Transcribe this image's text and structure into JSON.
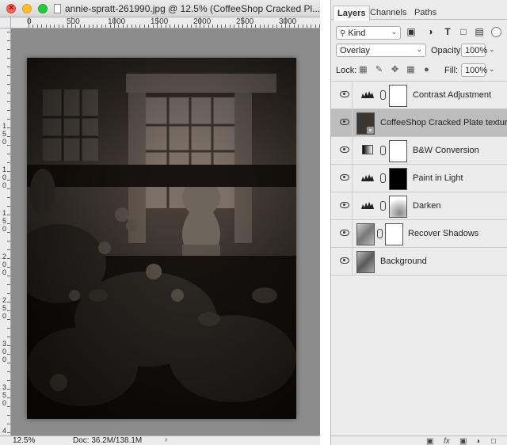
{
  "window": {
    "title": "annie-spratt-261990.jpg @ 12.5% (CoffeeShop Cracked Pl..."
  },
  "ruler": {
    "top_labels": [
      "0",
      "500",
      "1000",
      "1500",
      "2000",
      "2500",
      "3000"
    ],
    "left_labels": [
      "1",
      "5",
      "0",
      "1",
      "0",
      "0",
      "1",
      "5",
      "0",
      "2",
      "0",
      "0",
      "2",
      "5",
      "0",
      "3",
      "0",
      "0",
      "3",
      "5",
      "0",
      "4",
      "0",
      "0"
    ]
  },
  "status": {
    "zoom": "12.5%",
    "doc": "Doc: 36.2M/138.1M",
    "arrow": "›"
  },
  "panel": {
    "tabs": [
      "Layers",
      "Channels",
      "Paths"
    ],
    "kind_label": "Kind",
    "filter_icons": [
      "image-filter-icon",
      "adjustment-filter-icon",
      "type-filter-icon",
      "shape-filter-icon",
      "smart-object-filter-icon"
    ],
    "blend_mode": "Overlay",
    "opacity_label": "Opacity:",
    "opacity_value": "100%",
    "lock_label": "Lock:",
    "fill_label": "Fill:",
    "fill_value": "100%",
    "layers": [
      {
        "name": "Contrast Adjustment",
        "kind": "curves",
        "selected": false
      },
      {
        "name": "CoffeeShop Cracked Plate texture",
        "kind": "smart-object",
        "selected": true
      },
      {
        "name": "B&W Conversion",
        "kind": "gradient",
        "selected": false
      },
      {
        "name": "Paint in Light",
        "kind": "curves-black-mask",
        "selected": false
      },
      {
        "name": "Darken",
        "kind": "curves-gradient-mask",
        "selected": false
      },
      {
        "name": "Recover Shadows",
        "kind": "pixel-with-mask",
        "selected": false
      },
      {
        "name": "Background",
        "kind": "pixel",
        "selected": false
      }
    ]
  },
  "colors": {
    "selected_row": "#bdbdbd",
    "image_base": "#1f1a16",
    "pasteboard": "#8c8c8c"
  }
}
